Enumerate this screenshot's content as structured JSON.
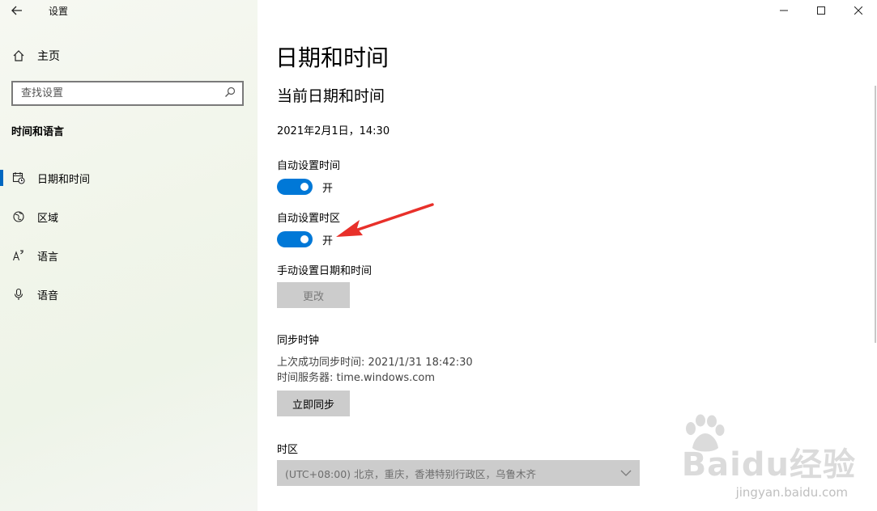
{
  "sidebar": {
    "app_title": "设置",
    "home_label": "主页",
    "search_placeholder": "查找设置",
    "section_title": "时间和语言",
    "items": [
      {
        "label": "日期和时间",
        "icon": "calendar-clock-icon",
        "active": true
      },
      {
        "label": "区域",
        "icon": "globe-icon",
        "active": false
      },
      {
        "label": "语言",
        "icon": "language-icon",
        "active": false
      },
      {
        "label": "语音",
        "icon": "microphone-icon",
        "active": false
      }
    ]
  },
  "main": {
    "title": "日期和时间",
    "subtitle": "当前日期和时间",
    "current_datetime": "2021年2月1日，14:30",
    "auto_time": {
      "label": "自动设置时间",
      "state": "开"
    },
    "auto_timezone": {
      "label": "自动设置时区",
      "state": "开"
    },
    "manual": {
      "label": "手动设置日期和时间",
      "button": "更改"
    },
    "sync": {
      "label": "同步时钟",
      "last_sync": "上次成功同步时间: 2021/1/31 18:42:30",
      "server": "时间服务器: time.windows.com",
      "button": "立即同步"
    },
    "timezone": {
      "label": "时区",
      "selected": "(UTC+08:00) 北京，重庆，香港特别行政区，乌鲁木齐"
    }
  },
  "watermark": {
    "brand": "Baidu经验",
    "url": "jingyan.baidu.com"
  },
  "colors": {
    "accent": "#0078d7",
    "arrow": "#e8302a",
    "button_bg": "#cccccc"
  }
}
